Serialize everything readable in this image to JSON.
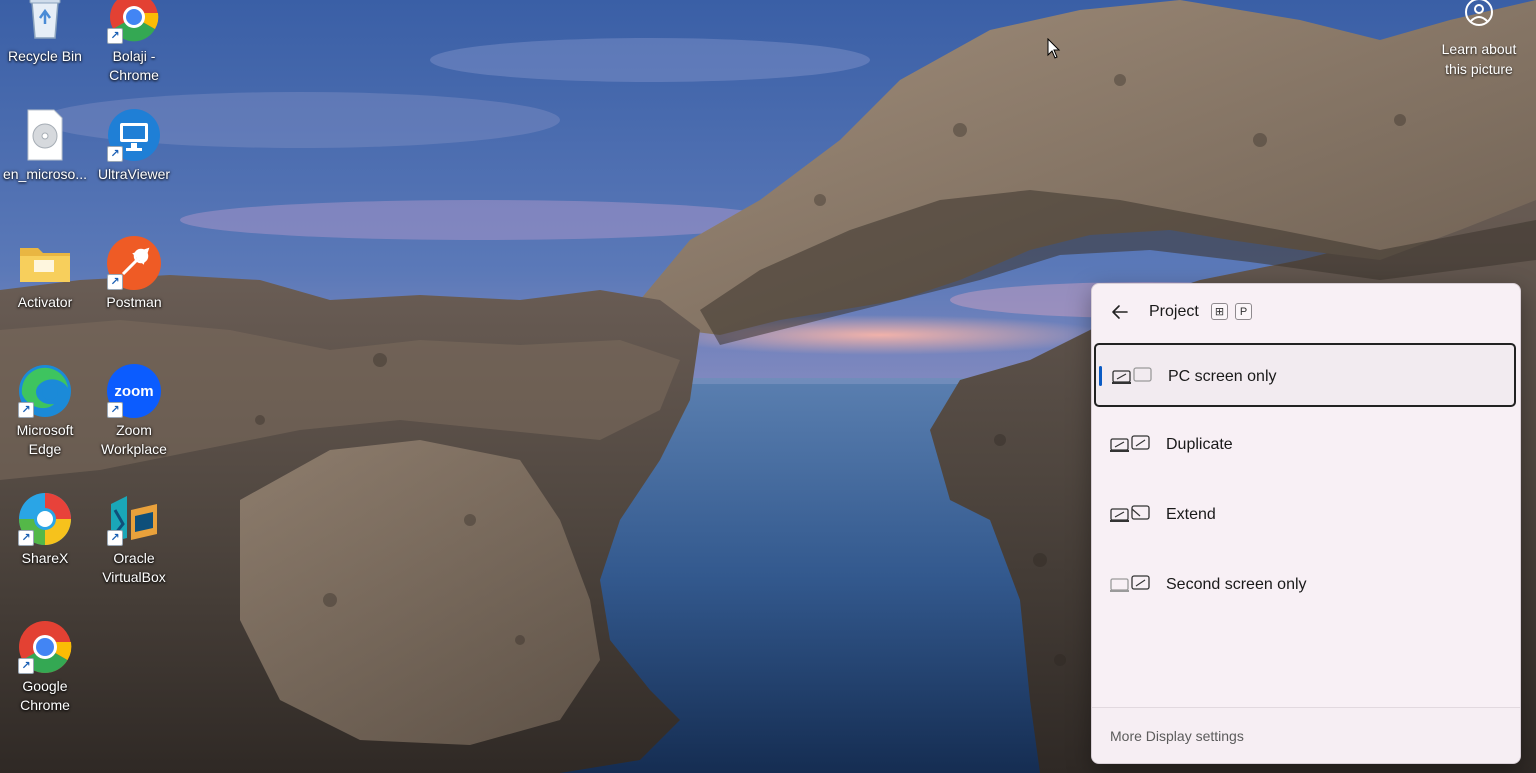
{
  "desktop": {
    "icons": [
      {
        "label": "Recycle Bin",
        "icon": "recycle-bin-icon"
      },
      {
        "label": "Bolaji - Chrome",
        "icon": "chrome-icon"
      },
      {
        "label": "en_microso...",
        "icon": "disc-image-file-icon"
      },
      {
        "label": "UltraViewer",
        "icon": "ultraviewer-icon"
      },
      {
        "label": "Activator",
        "icon": "folder-icon"
      },
      {
        "label": "Postman",
        "icon": "postman-icon"
      },
      {
        "label": "Microsoft Edge",
        "icon": "edge-icon"
      },
      {
        "label": "Zoom Workplace",
        "icon": "zoom-icon"
      },
      {
        "label": "ShareX",
        "icon": "sharex-icon"
      },
      {
        "label": "Oracle VirtualBox",
        "icon": "virtualbox-icon"
      },
      {
        "label": "Google Chrome",
        "icon": "chrome-icon"
      }
    ],
    "zoom_logo_text": "zoom",
    "learn_about_picture": "Learn about this picture"
  },
  "project_panel": {
    "title": "Project",
    "shortcut_keys": [
      "⊞",
      "P"
    ],
    "options": [
      {
        "label": "PC screen only",
        "selected": true,
        "icon": "pc-screen-only-icon"
      },
      {
        "label": "Duplicate",
        "selected": false,
        "icon": "duplicate-icon"
      },
      {
        "label": "Extend",
        "selected": false,
        "icon": "extend-icon"
      },
      {
        "label": "Second screen only",
        "selected": false,
        "icon": "second-screen-only-icon"
      }
    ],
    "footer_link": "More Display settings"
  },
  "colors": {
    "accent": "#0a5bc4",
    "panel_background": "#f8f0f5"
  }
}
